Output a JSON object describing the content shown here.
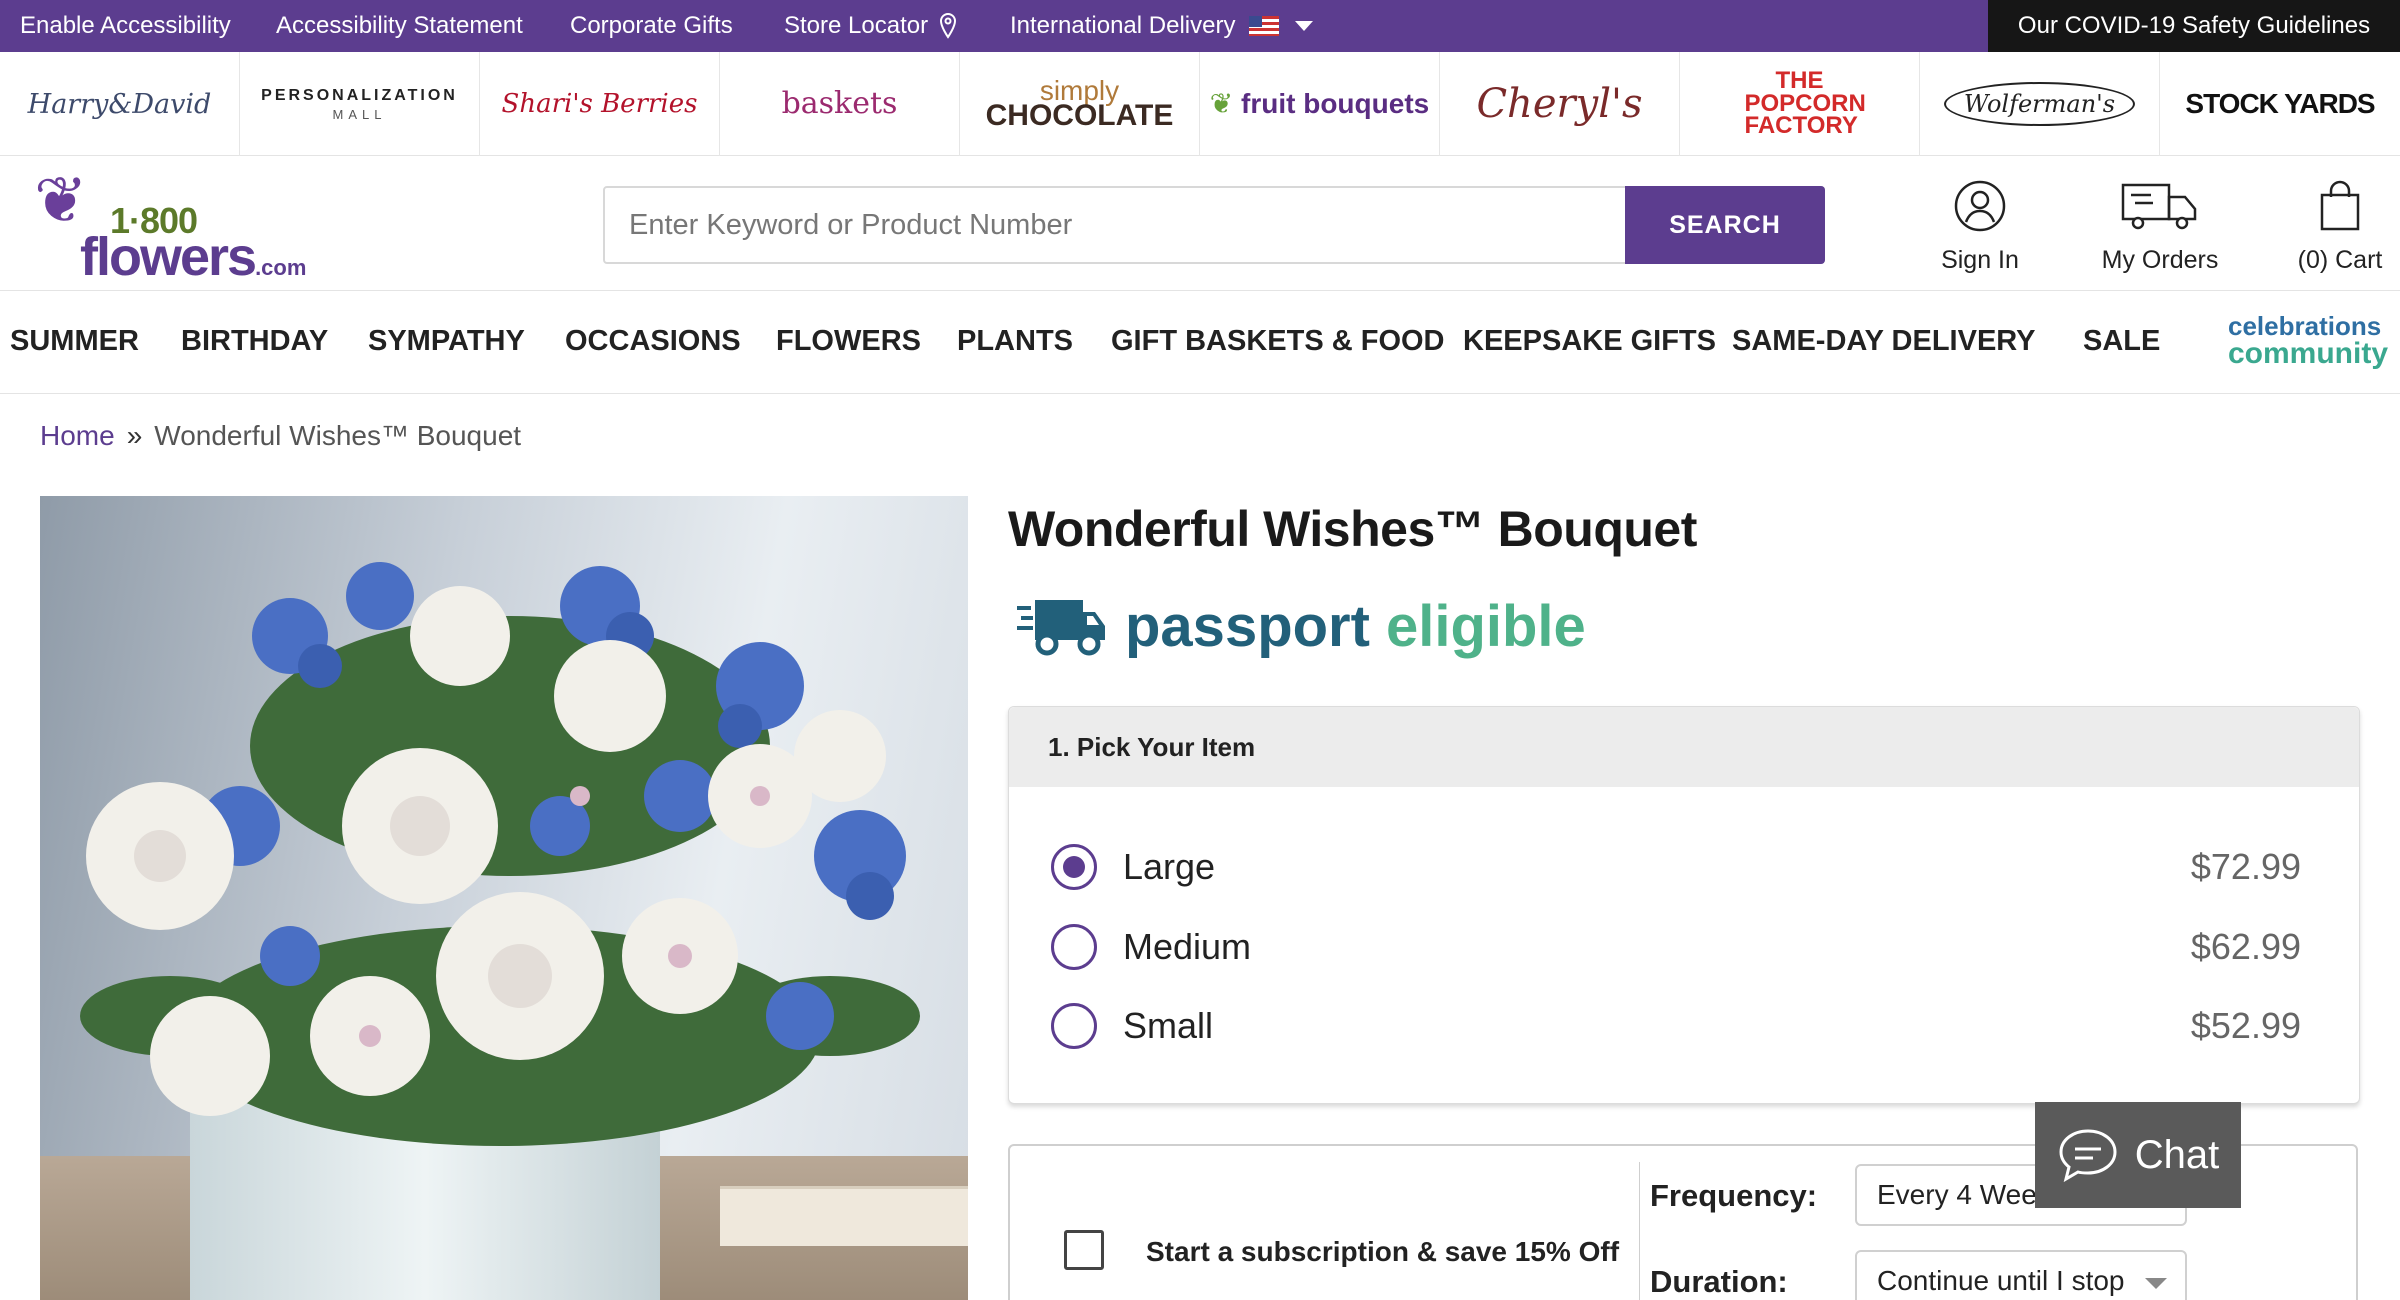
{
  "utility_bar": {
    "links": [
      "Enable Accessibility",
      "Accessibility Statement",
      "Corporate Gifts",
      "Store Locator",
      "International Delivery"
    ],
    "covid": "Our COVID-19 Safety Guidelines"
  },
  "brands": {
    "harry_david": "Harry&David",
    "personalization": "PERSONALIZATION",
    "personalization_sub": "MALL",
    "sharis": "Shari's Berries",
    "baskets": "baskets",
    "chocolate_top": "simply",
    "chocolate": "CHOCOLATE",
    "fruit": "fruit bouquets",
    "cheryls": "Cheryl's",
    "popcorn": "THE POPCORN FACTORY",
    "wolferman": "Wolferman's",
    "stockyards": "STOCK YARDS"
  },
  "logo": {
    "number": "1·800",
    "word": "flowers",
    "suffix": ".com"
  },
  "search": {
    "placeholder": "Enter Keyword or Product Number",
    "button": "SEARCH"
  },
  "header_actions": {
    "sign_in": "Sign In",
    "orders": "My Orders",
    "cart": "(0) Cart"
  },
  "nav": {
    "items": [
      "SUMMER",
      "BIRTHDAY",
      "SYMPATHY",
      "OCCASIONS",
      "FLOWERS",
      "PLANTS",
      "GIFT BASKETS & FOOD",
      "KEEPSAKE GIFTS",
      "SAME-DAY DELIVERY",
      "SALE"
    ],
    "community_1": "celebrations",
    "community_2": "community"
  },
  "breadcrumb": {
    "home": "Home",
    "separator": "»",
    "current": "Wonderful Wishes™ Bouquet"
  },
  "product": {
    "title": "Wonderful Wishes™ Bouquet",
    "passport_1": "passport",
    "passport_2": "eligible"
  },
  "pick": {
    "heading": "1. Pick Your Item",
    "options": [
      {
        "label": "Large",
        "price": "$72.99",
        "selected": true
      },
      {
        "label": "Medium",
        "price": "$62.99",
        "selected": false
      },
      {
        "label": "Small",
        "price": "$52.99",
        "selected": false
      }
    ]
  },
  "subscription": {
    "label": "Start a subscription & save 15% Off",
    "frequency_label": "Frequency:",
    "frequency_value": "Every 4 Weeks",
    "duration_label": "Duration:",
    "duration_value": "Continue until I stop"
  },
  "chat": {
    "label": "Chat"
  },
  "colors": {
    "brand_purple": "#5c3d8f",
    "covid_bg": "#161616",
    "passport_blue": "#22607a",
    "passport_green": "#4fb28a"
  }
}
